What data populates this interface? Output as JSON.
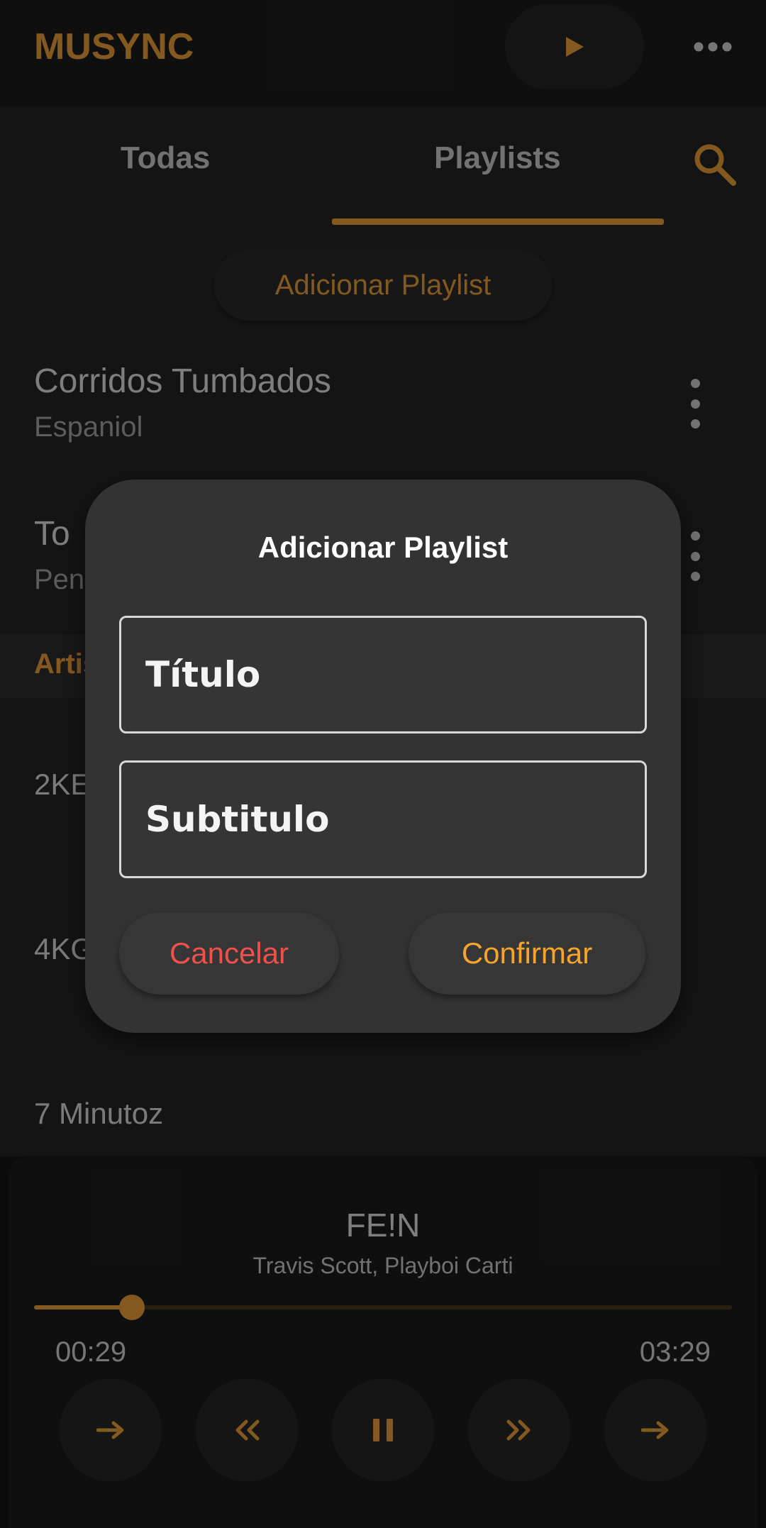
{
  "app": {
    "title": "MUSYNC"
  },
  "colors": {
    "accent": "#f0a33a",
    "danger": "#f0504a",
    "background": "#262626",
    "dialog": "#333333"
  },
  "header": {
    "play_icon": "play-icon",
    "more_icon": "more-horizontal-icon"
  },
  "tabs": [
    {
      "label": "Todas",
      "active": false
    },
    {
      "label": "Playlists",
      "active": true
    }
  ],
  "search_icon": "search-icon",
  "playlists_page": {
    "add_button_label": "Adicionar Playlist",
    "items": [
      {
        "title": "Corridos Tumbados",
        "subtitle": "Espaniol"
      },
      {
        "title": "To",
        "subtitle": "Pen"
      }
    ],
    "section_label": "Artis",
    "artists": [
      "2KE",
      "4KG",
      "7 Minutoz"
    ]
  },
  "dialog": {
    "title": "Adicionar Playlist",
    "title_field": {
      "placeholder": "Título",
      "value": ""
    },
    "subtitle_field": {
      "placeholder": "Subtitulo",
      "value": ""
    },
    "cancel_label": "Cancelar",
    "confirm_label": "Confirmar"
  },
  "player": {
    "track_title": "FE!N",
    "artist": "Travis Scott, Playboi Carti",
    "current_time": "00:29",
    "total_time": "03:29",
    "progress": 0.14,
    "controls": [
      "arrow-right-icon",
      "rewind-icon",
      "pause-icon",
      "fast-forward-icon",
      "arrow-right-icon"
    ]
  }
}
